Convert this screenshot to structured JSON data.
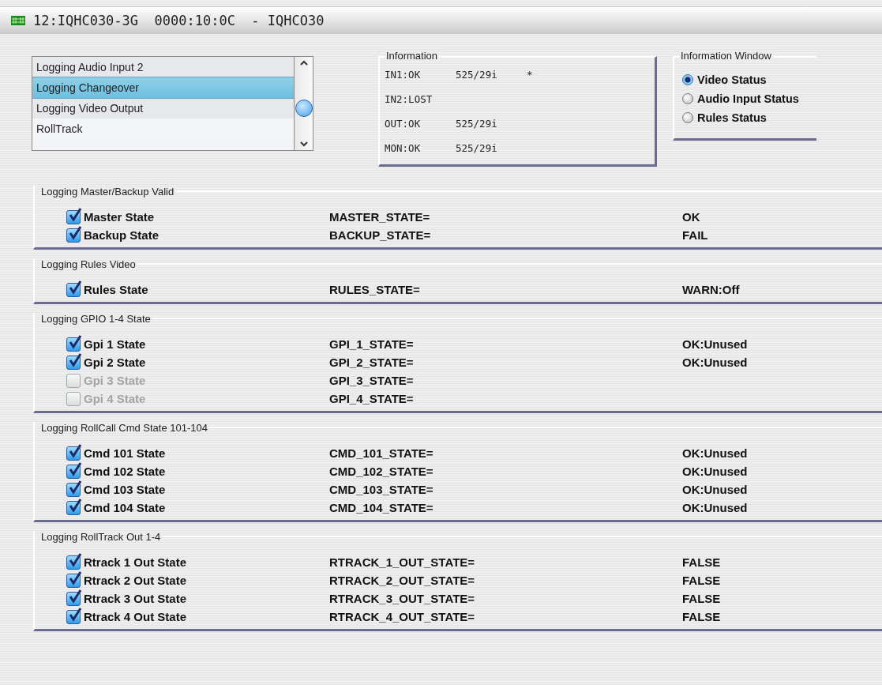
{
  "window": {
    "title": "12:IQHC030-3G  0000:10:0C  - IQHCO30"
  },
  "log_list": {
    "items": [
      {
        "label": "Logging Audio Input 2",
        "selected": false
      },
      {
        "label": "Logging Changeover",
        "selected": true
      },
      {
        "label": "Logging Video Output",
        "selected": false
      },
      {
        "label": "RollTrack",
        "selected": false
      }
    ]
  },
  "information": {
    "title": "Information",
    "lines": [
      [
        "IN1:OK",
        "525/29i",
        "*"
      ],
      [
        "IN2:LOST"
      ],
      [
        "OUT:OK",
        "525/29i"
      ],
      [
        "MON:OK",
        "525/29i"
      ]
    ]
  },
  "information_window": {
    "title": "Information Window",
    "options": [
      {
        "label": "Video Status",
        "selected": true
      },
      {
        "label": "Audio Input Status",
        "selected": false
      },
      {
        "label": "Rules Status",
        "selected": false
      }
    ]
  },
  "groups": [
    {
      "title": "Logging Master/Backup Valid",
      "rows": [
        {
          "label": "Master State",
          "checked": true,
          "variable": "MASTER_STATE=",
          "value": "OK"
        },
        {
          "label": "Backup State",
          "checked": true,
          "variable": "BACKUP_STATE=",
          "value": "FAIL"
        }
      ]
    },
    {
      "title": "Logging Rules Video",
      "rows": [
        {
          "label": "Rules State",
          "checked": true,
          "variable": "RULES_STATE=",
          "value": "WARN:Off"
        }
      ]
    },
    {
      "title": "Logging GPIO 1-4 State",
      "rows": [
        {
          "label": "Gpi 1 State",
          "checked": true,
          "variable": "GPI_1_STATE=",
          "value": "OK:Unused"
        },
        {
          "label": "Gpi 2 State",
          "checked": true,
          "variable": "GPI_2_STATE=",
          "value": "OK:Unused"
        },
        {
          "label": "Gpi 3 State",
          "checked": false,
          "variable": "GPI_3_STATE="
        },
        {
          "label": "Gpi 4 State",
          "checked": false,
          "variable": "GPI_4_STATE="
        }
      ]
    },
    {
      "title": "Logging RollCall Cmd State 101-104",
      "rows": [
        {
          "label": "Cmd 101 State",
          "checked": true,
          "variable": "CMD_101_STATE=",
          "value": "OK:Unused"
        },
        {
          "label": "Cmd 102 State",
          "checked": true,
          "variable": "CMD_102_STATE=",
          "value": "OK:Unused"
        },
        {
          "label": "Cmd 103 State",
          "checked": true,
          "variable": "CMD_103_STATE=",
          "value": "OK:Unused"
        },
        {
          "label": "Cmd 104 State",
          "checked": true,
          "variable": "CMD_104_STATE=",
          "value": "OK:Unused"
        }
      ]
    },
    {
      "title": "Logging RollTrack Out 1-4",
      "rows": [
        {
          "label": "Rtrack 1 Out State",
          "checked": true,
          "variable": "RTRACK_1_OUT_STATE=",
          "value": "FALSE"
        },
        {
          "label": "Rtrack 2 Out State",
          "checked": true,
          "variable": "RTRACK_2_OUT_STATE=",
          "value": "FALSE"
        },
        {
          "label": "Rtrack 3 Out State",
          "checked": true,
          "variable": "RTRACK_3_OUT_STATE=",
          "value": "FALSE"
        },
        {
          "label": "Rtrack 4 Out State",
          "checked": true,
          "variable": "RTRACK_4_OUT_STATE=",
          "value": "FALSE"
        }
      ]
    }
  ]
}
